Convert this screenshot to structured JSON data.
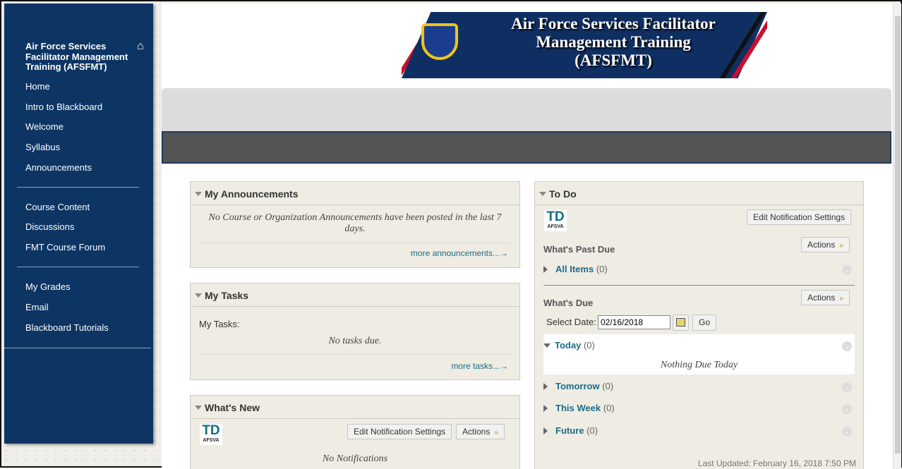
{
  "sidebar": {
    "course_title": "Air Force Services Facilitator Management Training (AFSFMT)",
    "group1": [
      "Home",
      "Intro to Blackboard",
      "Welcome",
      "Syllabus",
      "Announcements"
    ],
    "group2": [
      "Course Content",
      "Discussions",
      "FMT Course Forum"
    ],
    "group3": [
      "My Grades",
      "Email",
      "Blackboard Tutorials"
    ]
  },
  "banner": {
    "line1": "Air Force Services Facilitator",
    "line2": "Management Training",
    "line3": "(AFSFMT)"
  },
  "announcements": {
    "title": "My Announcements",
    "empty": "No Course or Organization Announcements have been posted in the last 7 days.",
    "more": "more announcements...→"
  },
  "tasks": {
    "title": "My Tasks",
    "label": "My Tasks:",
    "empty": "No tasks due.",
    "more": "more tasks...→"
  },
  "whatsnew": {
    "title": "What's New",
    "edit": "Edit Notification Settings",
    "actions": "Actions",
    "empty": "No Notifications"
  },
  "logo": {
    "top": "TD",
    "bottom": "AFSVA"
  },
  "todo": {
    "title": "To Do",
    "edit": "Edit Notification Settings",
    "past_due": "What's Past Due",
    "actions": "Actions",
    "all_items": "All Items",
    "all_count": "(0)",
    "whats_due": "What's Due",
    "select_date": "Select Date:",
    "date": "02/16/2018",
    "go": "Go",
    "today": "Today",
    "today_count": "(0)",
    "nothing_today": "Nothing Due Today",
    "tomorrow": "Tomorrow",
    "tomorrow_count": "(0)",
    "this_week": "This Week",
    "this_week_count": "(0)",
    "future": "Future",
    "future_count": "(0)",
    "last_updated": "Last Updated: February 16, 2018 7:50 PM"
  }
}
